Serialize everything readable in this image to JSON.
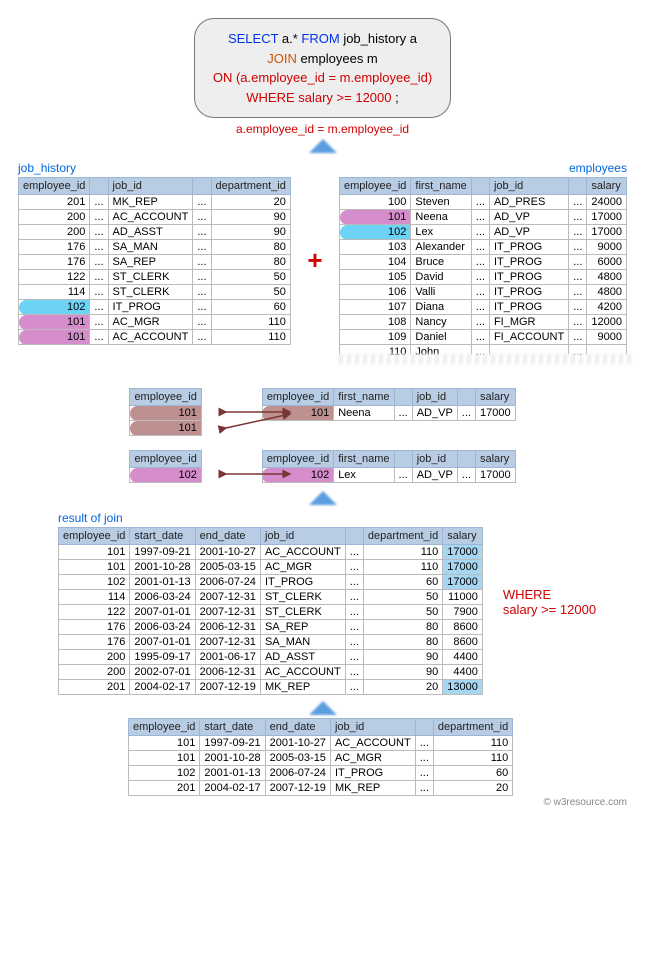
{
  "sql": {
    "line1a": "SELECT ",
    "line1b": "a.* ",
    "line1c": "FROM  ",
    "line1d": "job_history a",
    "line2a": "JOIN ",
    "line2b": "employees m",
    "line3a": "ON ",
    "line3b": "(a.employee_id = m.employee_id)",
    "line4a": "WHERE ",
    "line4b": "salary >= 12000",
    "line4c": ";"
  },
  "join_caption": "a.employee_id = m.employee_id",
  "labels": {
    "job_history": "job_history",
    "employees": "employees",
    "result": "result of join"
  },
  "cols_jh": [
    "employee_id",
    "",
    "job_id",
    "",
    "department_id"
  ],
  "rows_jh": [
    {
      "id": "201",
      "j": "MK_REP",
      "d": "20",
      "pill": ""
    },
    {
      "id": "200",
      "j": "AC_ACCOUNT",
      "d": "90",
      "pill": ""
    },
    {
      "id": "200",
      "j": "AD_ASST",
      "d": "90",
      "pill": ""
    },
    {
      "id": "176",
      "j": "SA_MAN",
      "d": "80",
      "pill": ""
    },
    {
      "id": "176",
      "j": "SA_REP",
      "d": "80",
      "pill": ""
    },
    {
      "id": "122",
      "j": "ST_CLERK",
      "d": "50",
      "pill": ""
    },
    {
      "id": "114",
      "j": "ST_CLERK",
      "d": "50",
      "pill": ""
    },
    {
      "id": "102",
      "j": "IT_PROG",
      "d": "60",
      "pill": "cyan"
    },
    {
      "id": "101",
      "j": "AC_MGR",
      "d": "110",
      "pill": "mag"
    },
    {
      "id": "101",
      "j": "AC_ACCOUNT",
      "d": "110",
      "pill": "mag"
    }
  ],
  "cols_emp": [
    "employee_id",
    "first_name",
    "",
    "job_id",
    "",
    "salary"
  ],
  "rows_emp": [
    {
      "id": "100",
      "n": "Steven",
      "j": "AD_PRES",
      "s": "24000",
      "pill": ""
    },
    {
      "id": "101",
      "n": "Neena",
      "j": "AD_VP",
      "s": "17000",
      "pill": "mag"
    },
    {
      "id": "102",
      "n": "Lex",
      "j": "AD_VP",
      "s": "17000",
      "pill": "cyan"
    },
    {
      "id": "103",
      "n": "Alexander",
      "j": "IT_PROG",
      "s": "9000",
      "pill": ""
    },
    {
      "id": "104",
      "n": "Bruce",
      "j": "IT_PROG",
      "s": "6000",
      "pill": ""
    },
    {
      "id": "105",
      "n": "David",
      "j": "IT_PROG",
      "s": "4800",
      "pill": ""
    },
    {
      "id": "106",
      "n": "Valli",
      "j": "IT_PROG",
      "s": "4800",
      "pill": ""
    },
    {
      "id": "107",
      "n": "Diana",
      "j": "IT_PROG",
      "s": "4200",
      "pill": ""
    },
    {
      "id": "108",
      "n": "Nancy",
      "j": "FI_MGR",
      "s": "12000",
      "pill": ""
    },
    {
      "id": "109",
      "n": "Daniel",
      "j": "FI_ACCOUNT",
      "s": "9000",
      "pill": ""
    },
    {
      "id": "110",
      "n": "John",
      "j": "",
      "s": "",
      "pill": ""
    }
  ],
  "mini_left_col": "employee_id",
  "mini_right_cols": [
    "employee_id",
    "first_name",
    "",
    "job_id",
    "",
    "salary"
  ],
  "match1_left": [
    "101",
    "101"
  ],
  "match1_right": {
    "id": "101",
    "n": "Neena",
    "j": "AD_VP",
    "s": "17000"
  },
  "match2_left": [
    "102"
  ],
  "match2_right": {
    "id": "102",
    "n": "Lex",
    "j": "AD_VP",
    "s": "17000"
  },
  "cols_result": [
    "employee_id",
    "start_date",
    "end_date",
    "job_id",
    "",
    "department_id",
    "salary"
  ],
  "rows_result": [
    {
      "id": "101",
      "sd": "1997-09-21",
      "ed": "2001-10-27",
      "j": "AC_ACCOUNT",
      "d": "110",
      "s": "17000",
      "hi": true
    },
    {
      "id": "101",
      "sd": "2001-10-28",
      "ed": "2005-03-15",
      "j": "AC_MGR",
      "d": "110",
      "s": "17000",
      "hi": true
    },
    {
      "id": "102",
      "sd": "2001-01-13",
      "ed": "2006-07-24",
      "j": "IT_PROG",
      "d": "60",
      "s": "17000",
      "hi": true
    },
    {
      "id": "114",
      "sd": "2006-03-24",
      "ed": "2007-12-31",
      "j": "ST_CLERK",
      "d": "50",
      "s": "11000",
      "hi": false
    },
    {
      "id": "122",
      "sd": "2007-01-01",
      "ed": "2007-12-31",
      "j": "ST_CLERK",
      "d": "50",
      "s": "7900",
      "hi": false
    },
    {
      "id": "176",
      "sd": "2006-03-24",
      "ed": "2006-12-31",
      "j": "SA_REP",
      "d": "80",
      "s": "8600",
      "hi": false
    },
    {
      "id": "176",
      "sd": "2007-01-01",
      "ed": "2007-12-31",
      "j": "SA_MAN",
      "d": "80",
      "s": "8600",
      "hi": false
    },
    {
      "id": "200",
      "sd": "1995-09-17",
      "ed": "2001-06-17",
      "j": "AD_ASST",
      "d": "90",
      "s": "4400",
      "hi": false
    },
    {
      "id": "200",
      "sd": "2002-07-01",
      "ed": "2006-12-31",
      "j": "AC_ACCOUNT",
      "d": "90",
      "s": "4400",
      "hi": false
    },
    {
      "id": "201",
      "sd": "2004-02-17",
      "ed": "2007-12-19",
      "j": "MK_REP",
      "d": "20",
      "s": "13000",
      "hi": true
    }
  ],
  "where_label": "WHERE\nsalary >= 12000",
  "cols_final": [
    "employee_id",
    "start_date",
    "end_date",
    "job_id",
    "",
    "department_id"
  ],
  "rows_final": [
    {
      "id": "101",
      "sd": "1997-09-21",
      "ed": "2001-10-27",
      "j": "AC_ACCOUNT",
      "d": "110"
    },
    {
      "id": "101",
      "sd": "2001-10-28",
      "ed": "2005-03-15",
      "j": "AC_MGR",
      "d": "110"
    },
    {
      "id": "102",
      "sd": "2001-01-13",
      "ed": "2006-07-24",
      "j": "IT_PROG",
      "d": "60"
    },
    {
      "id": "201",
      "sd": "2004-02-17",
      "ed": "2007-12-19",
      "j": "MK_REP",
      "d": "20"
    }
  ],
  "footer": "© w3resource.com"
}
